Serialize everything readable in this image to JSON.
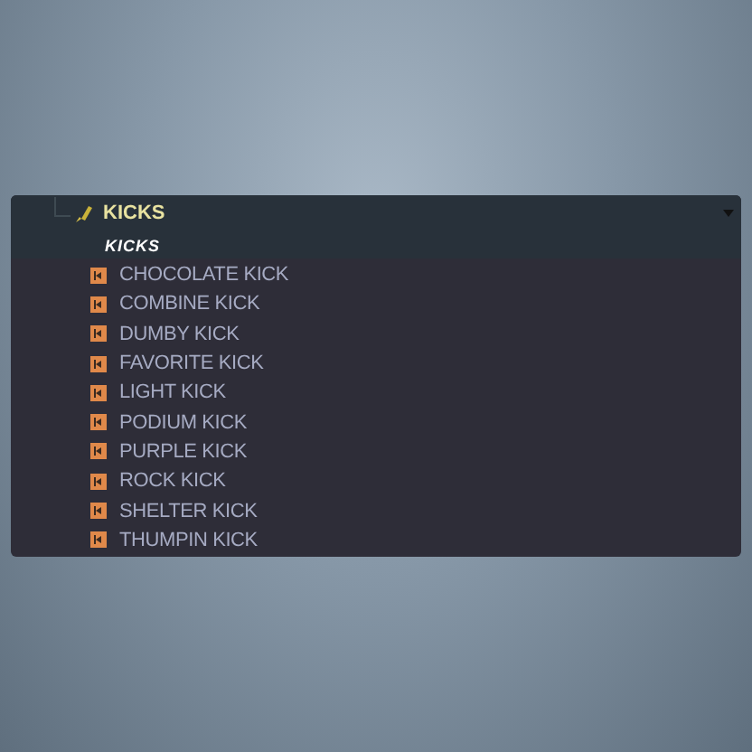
{
  "folder": {
    "label": "KICKS",
    "expanded": true
  },
  "subtitle": "KICKS",
  "items": [
    {
      "label": "CHOCOLATE KICK"
    },
    {
      "label": "COMBINE KICK"
    },
    {
      "label": "DUMBY KICK"
    },
    {
      "label": "FAVORITE KICK"
    },
    {
      "label": "LIGHT KICK"
    },
    {
      "label": "PODIUM KICK"
    },
    {
      "label": "PURPLE KICK"
    },
    {
      "label": "ROCK KICK"
    },
    {
      "label": "SHELTER KICK"
    },
    {
      "label": "THUMPIN KICK"
    }
  ]
}
